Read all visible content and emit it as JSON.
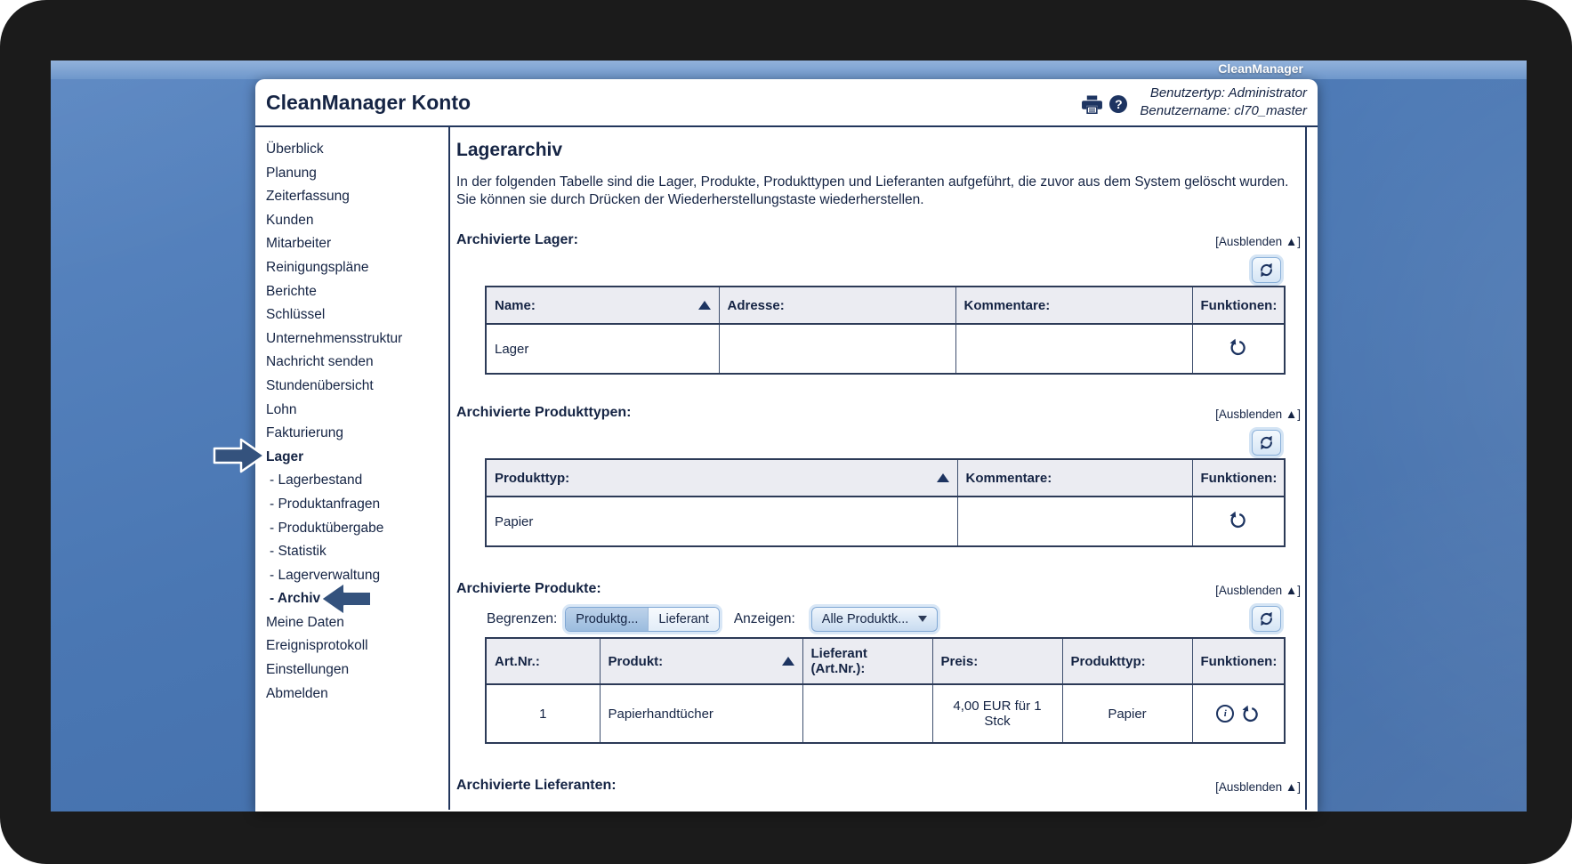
{
  "titlebar": {
    "app_name": "CleanManager"
  },
  "header": {
    "title": "CleanManager Konto",
    "user_type": "Benutzertyp: Administrator",
    "user_name": "Benutzername: cl70_master"
  },
  "icons": {
    "help_glyph": "?",
    "info_glyph": "i"
  },
  "sidebar": {
    "items": [
      "Überblick",
      "Planung",
      "Zeiterfassung",
      "Kunden",
      "Mitarbeiter",
      "Reinigungspläne",
      "Berichte",
      "Schlüssel",
      "Unternehmensstruktur",
      "Nachricht senden",
      "Stundenübersicht",
      "Lohn",
      "Fakturierung",
      "Lager",
      "- Lagerbestand",
      "- Produktanfragen",
      "- Produktübergabe",
      "- Statistik",
      "- Lagerverwaltung",
      "- Archiv",
      "Meine Daten",
      "Ereignisprotokoll",
      "Einstellungen",
      "Abmelden"
    ]
  },
  "main": {
    "page_title": "Lagerarchiv",
    "intro_line1": "In der folgenden Tabelle sind die Lager, Produkte, Produkttypen und Lieferanten aufgeführt, die zuvor aus dem System gelöscht wurden.",
    "intro_line2": "Sie können sie durch Drücken der Wiederherstellungstaste wiederherstellen.",
    "hide_toggle": "[Ausblenden ▲]",
    "sections": {
      "lager": {
        "heading": "Archivierte Lager:",
        "columns": [
          "Name:",
          "Adresse:",
          "Kommentare:",
          "Funktionen:"
        ],
        "rows": [
          {
            "name": "Lager",
            "adresse": "",
            "kommentare": ""
          }
        ]
      },
      "produkttypen": {
        "heading": "Archivierte Produkttypen:",
        "columns": [
          "Produkttyp:",
          "Kommentare:",
          "Funktionen:"
        ],
        "rows": [
          {
            "produkttyp": "Papier",
            "kommentare": ""
          }
        ]
      },
      "produkte": {
        "heading": "Archivierte Produkte:",
        "filter": {
          "begrenzen_label": "Begrenzen:",
          "produktgruppe_button": "Produktg...",
          "lieferant_button": "Lieferant",
          "anzeigen_label": "Anzeigen:",
          "dropdown_value": "Alle Produktk..."
        },
        "columns": [
          "Art.Nr.:",
          "Produkt:",
          "Lieferant (Art.Nr.):",
          "Preis:",
          "Produkttyp:",
          "Funktionen:"
        ],
        "rows": [
          {
            "artnr": "1",
            "produkt": "Papierhandtücher",
            "lieferant": "",
            "preis": "4,00 EUR für 1 Stck",
            "produkttyp": "Papier"
          }
        ]
      },
      "lieferanten": {
        "heading": "Archivierte Lieferanten:"
      }
    }
  }
}
